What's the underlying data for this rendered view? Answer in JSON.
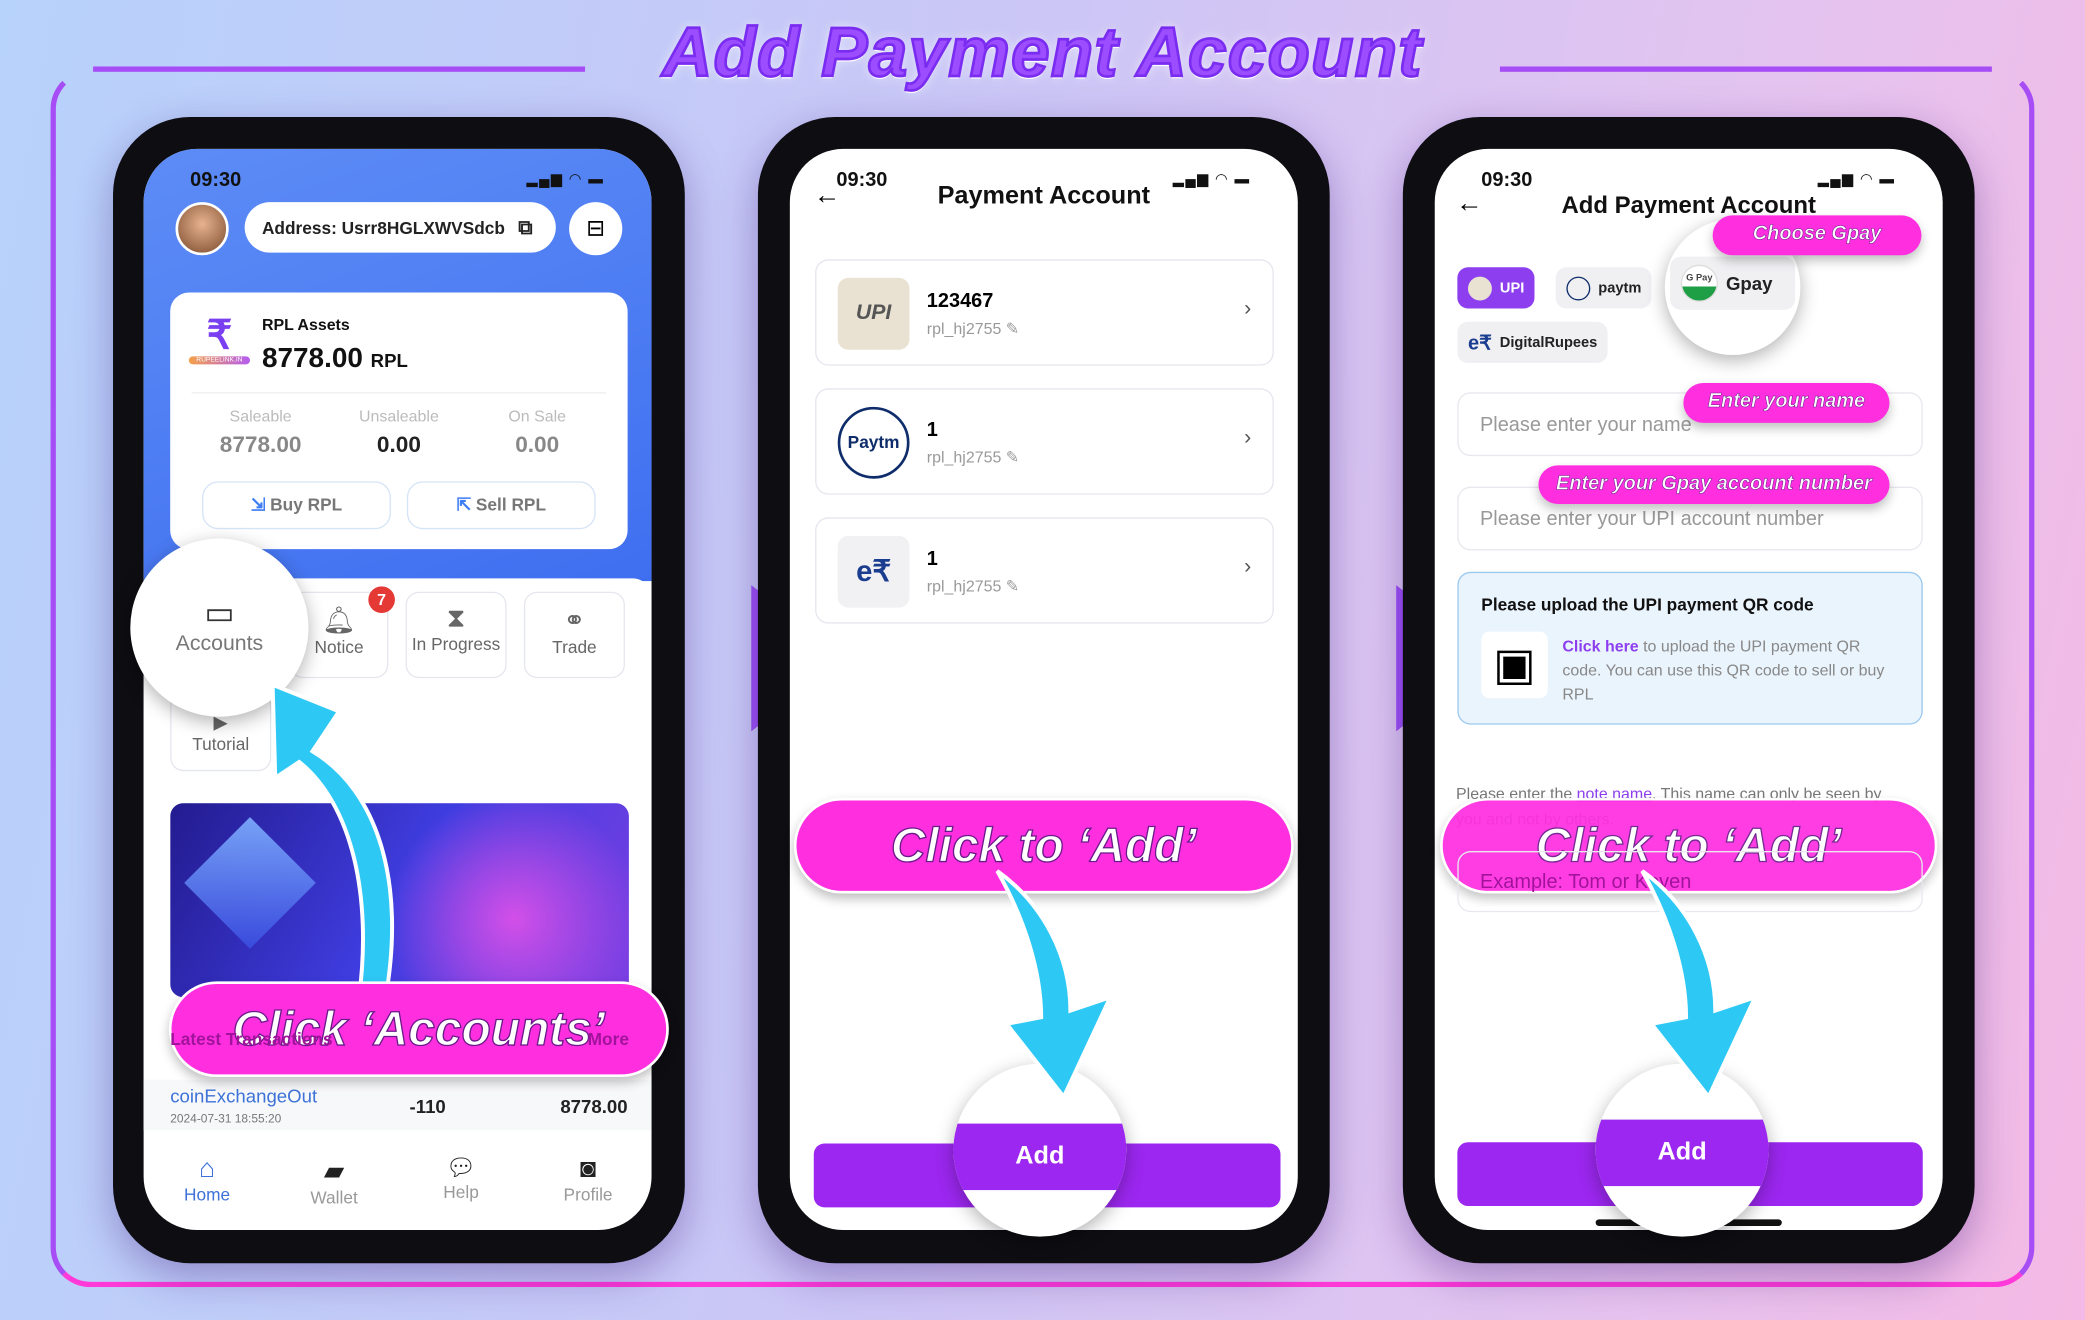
{
  "title": "Add Payment Account",
  "colors": {
    "accent": "#9c27f0",
    "callout": "#ff2fe0",
    "brand_blue": "#4a7df5",
    "badge": "#e53935"
  },
  "status": {
    "time": "09:30"
  },
  "phone1": {
    "address": "Address: Usrr8HGLXWVSdcb",
    "assets_label": "RPL Assets",
    "assets_value": "8778.00",
    "assets_unit": "RPL",
    "logo_text": "RUPEELINK.IN",
    "stats": [
      {
        "label": "Saleable",
        "value": "8778.00"
      },
      {
        "label": "Unsaleable",
        "value": "0.00"
      },
      {
        "label": "On Sale",
        "value": "0.00"
      }
    ],
    "buy": "Buy RPL",
    "sell": "Sell RPL",
    "tiles": [
      {
        "label": "Accounts",
        "icon": "wallet-icon"
      },
      {
        "label": "Notice",
        "icon": "bell-icon",
        "badge": "7"
      },
      {
        "label": "In Progress",
        "icon": "hourglass-icon"
      },
      {
        "label": "Trade",
        "icon": "trade-icon"
      },
      {
        "label": "Tutorial",
        "icon": "play-icon"
      }
    ],
    "latest_label": "Latest Transactions",
    "more": "More",
    "tx": {
      "name": "coinExchangeOut",
      "date": "2024-07-31 18:55:20",
      "amount": "-110",
      "balance": "8778.00"
    },
    "nav": [
      {
        "label": "Home",
        "icon": "home-icon",
        "active": true
      },
      {
        "label": "Wallet",
        "icon": "wallet-icon"
      },
      {
        "label": "Help",
        "icon": "chat-icon"
      },
      {
        "label": "Profile",
        "icon": "profile-icon"
      }
    ],
    "callout": "Click  ‘Accounts’"
  },
  "phone2": {
    "title": "Payment Account",
    "accounts": [
      {
        "name": "123467",
        "id": "rpl_hj2755",
        "logo": "UPI"
      },
      {
        "name": "1",
        "id": "rpl_hj2755",
        "logo": "Paytm"
      },
      {
        "name": "1",
        "id": "rpl_hj2755",
        "logo": "e₹"
      }
    ],
    "callout": "Click to ‘Add’",
    "add": "Add"
  },
  "phone3": {
    "title": "Add Payment Account",
    "chips": [
      {
        "label": "UPI",
        "selected": true
      },
      {
        "label": "paytm"
      },
      {
        "label": "Gpay"
      },
      {
        "label": "DigitalRupees"
      }
    ],
    "gpay_logo": "G Pay",
    "name_placeholder": "Please enter your name",
    "account_placeholder": "Please enter your UPI account number",
    "qr_title": "Please upload the UPI payment QR code",
    "qr_link": "Click here",
    "qr_text": " to upload the UPI payment QR code. You can use this QR code to sell or buy RPL",
    "note_pre": "Please enter the ",
    "note_link": "note name",
    "note_post": ". This name can only be seen by you and not by others.",
    "note_placeholder": "Example: Tom or Keven",
    "callout_choose": "Choose Gpay",
    "callout_name": "Enter your name",
    "callout_account": "Enter your Gpay account number",
    "callout": "Click to ‘Add’",
    "add": "Add"
  }
}
